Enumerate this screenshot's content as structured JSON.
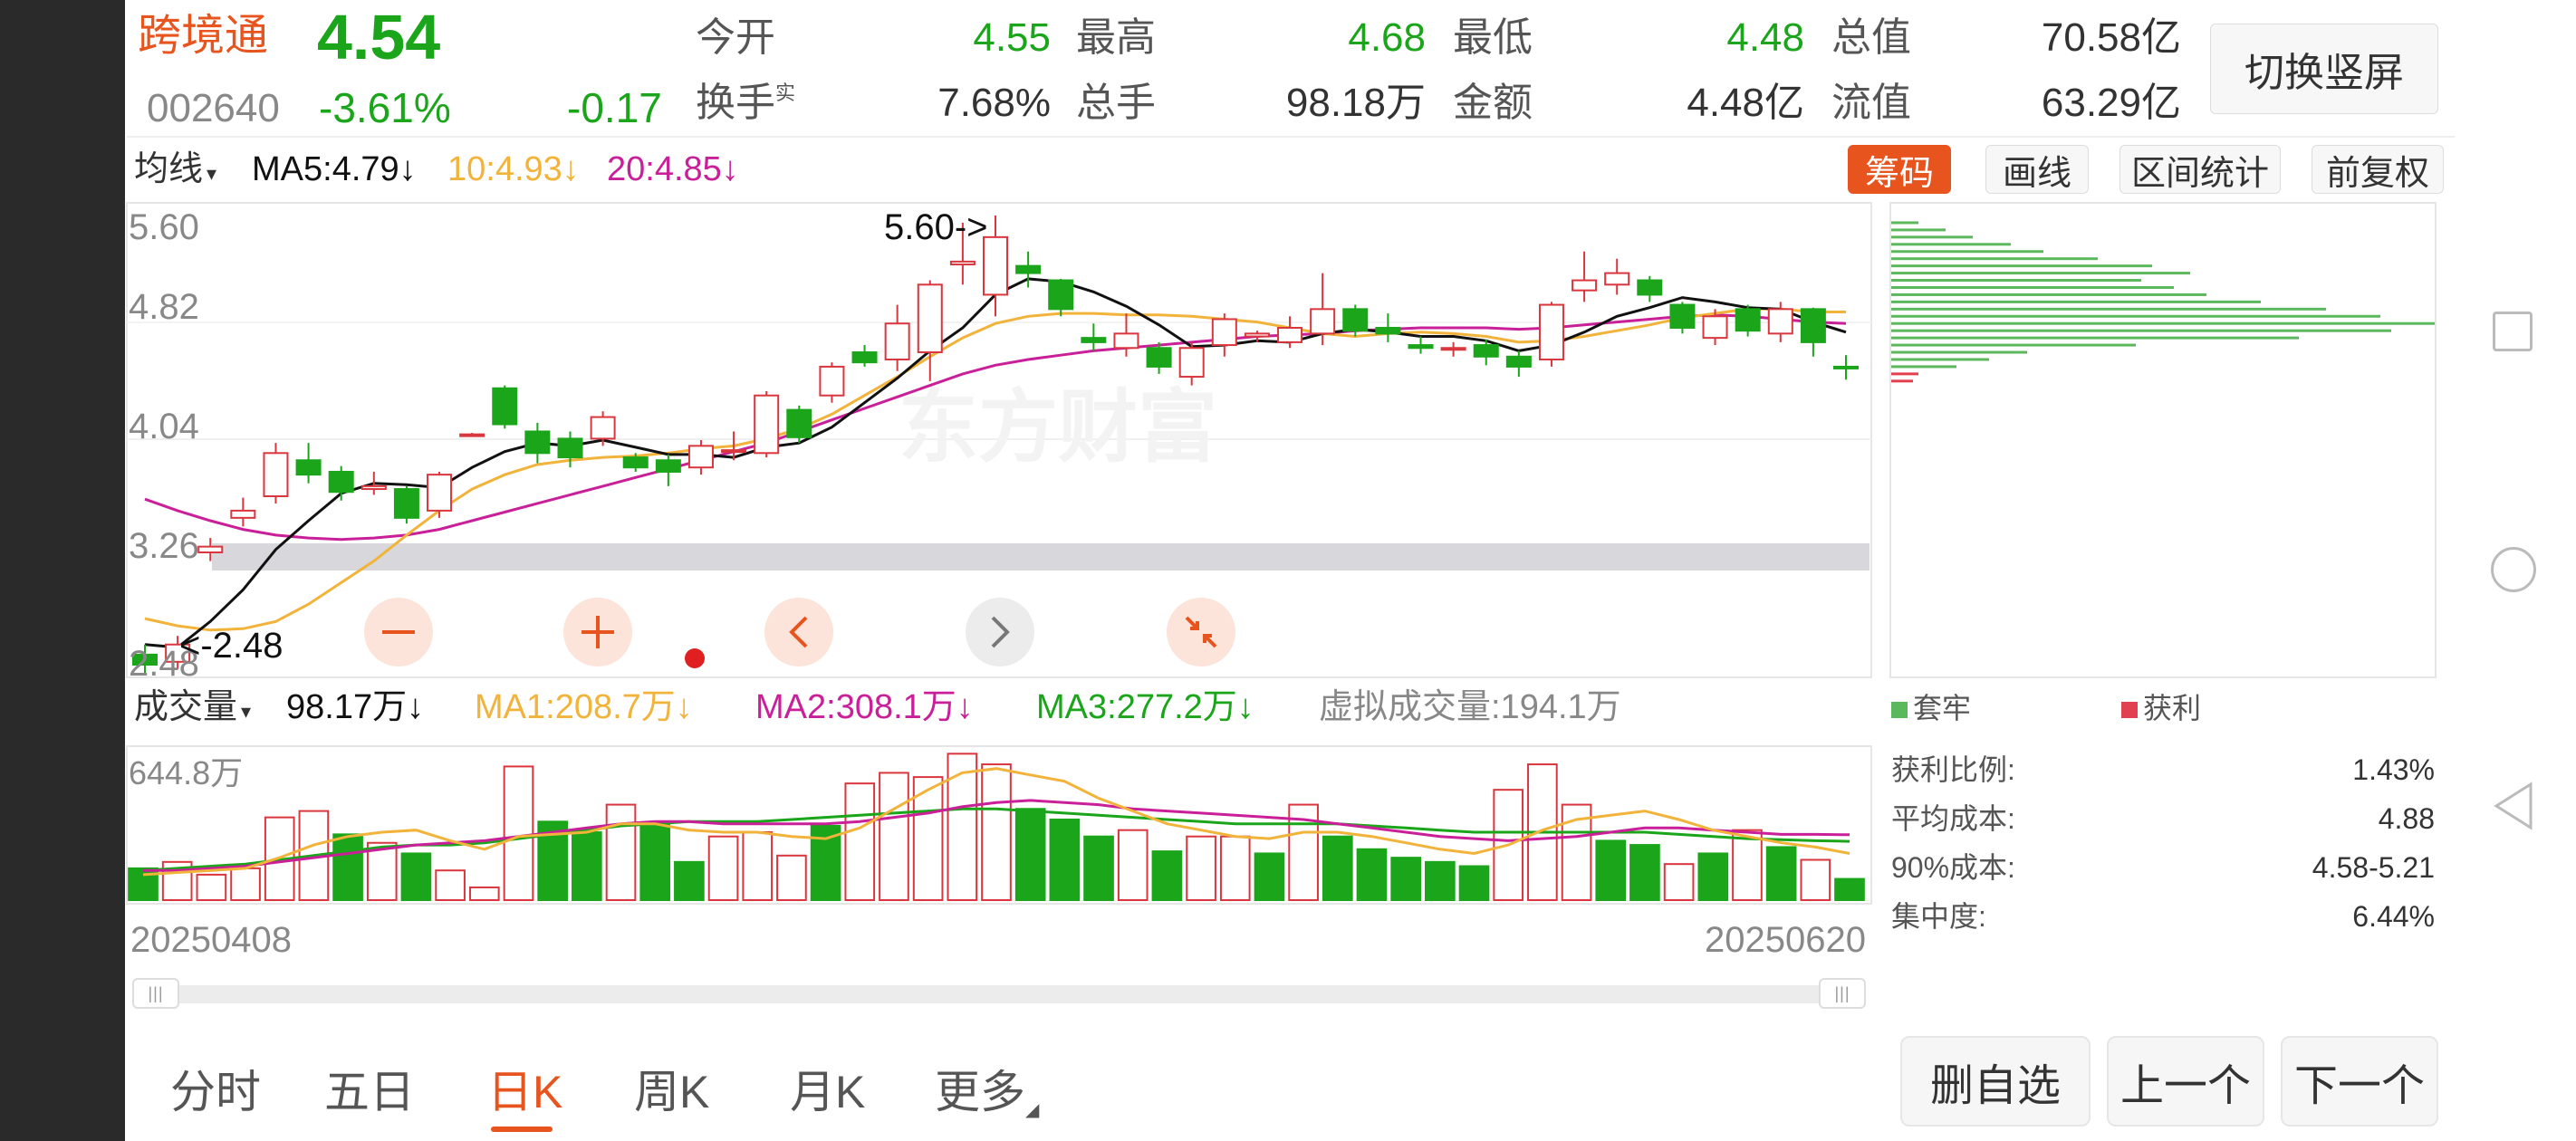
{
  "header": {
    "name": "跨境通",
    "price": "4.54",
    "code": "002640",
    "change_pct": "-3.61%",
    "change_abs": "-0.17",
    "stats": [
      {
        "label": "今开",
        "value": "4.55"
      },
      {
        "label": "最高",
        "value": "4.68"
      },
      {
        "label": "最低",
        "value": "4.48"
      },
      {
        "label": "总值",
        "value": "70.58亿"
      },
      {
        "label": "换手",
        "sup": "实",
        "value": "7.68%"
      },
      {
        "label": "总手",
        "value": "98.18万"
      },
      {
        "label": "金额",
        "value": "4.48亿"
      },
      {
        "label": "流值",
        "value": "63.29亿"
      }
    ],
    "switch_button": "切换竖屏"
  },
  "ma_bar": {
    "dropdown": "均线",
    "ma5": "MA5:4.79",
    "ma10": "10:4.93",
    "ma20": "20:4.85",
    "arrow": "↓",
    "tools": [
      "筹码",
      "画线",
      "区间统计",
      "前复权"
    ]
  },
  "kline": {
    "y_labels": [
      "5.60",
      "4.82",
      "4.04",
      "3.26",
      "2.48"
    ],
    "high_annotation": "5.60->",
    "low_annotation": "<-2.48",
    "watermark": "东方财富"
  },
  "volume_bar": {
    "dropdown": "成交量",
    "vol": "98.17万",
    "ma1": "MA1:208.7万",
    "ma2": "MA2:308.1万",
    "ma3": "MA3:277.2万",
    "arrow": "↓",
    "virtual": "虚拟成交量:194.1万",
    "y_label": "644.8万",
    "date_start": "20250408",
    "date_end": "20250620"
  },
  "chip": {
    "legend_trapped": "套牢",
    "legend_profit": "获利",
    "rows": [
      {
        "label": "获利比例:",
        "value": "1.43%"
      },
      {
        "label": "平均成本:",
        "value": "4.88"
      },
      {
        "label": "90%成本:",
        "value": "4.58-5.21"
      },
      {
        "label": "集中度:",
        "value": "6.44%"
      }
    ]
  },
  "tabs": [
    "分时",
    "五日",
    "日K",
    "周K",
    "月K",
    "更多"
  ],
  "active_tab": "日K",
  "bottom_buttons": [
    "删自选",
    "上一个",
    "下一个"
  ],
  "colors": {
    "up": "#d9363e",
    "down": "#1aa51a",
    "ma5": "#111111",
    "ma10": "#f2b33b",
    "ma20": "#c9209a",
    "accent": "#e8541e"
  },
  "chart_data": {
    "type": "candlestick",
    "price_axis": [
      2.48,
      5.6
    ],
    "ma_legend": {
      "MA5": 4.79,
      "MA10": 4.93,
      "MA20": 4.85
    },
    "candles": [
      {
        "o": 2.55,
        "c": 2.48,
        "h": 2.62,
        "l": 2.42
      },
      {
        "o": 2.5,
        "c": 2.62,
        "h": 2.68,
        "l": 2.45
      },
      {
        "o": 3.26,
        "c": 3.3,
        "h": 3.36,
        "l": 3.2
      },
      {
        "o": 3.5,
        "c": 3.55,
        "h": 3.64,
        "l": 3.44
      },
      {
        "o": 3.65,
        "c": 3.95,
        "h": 4.02,
        "l": 3.6
      },
      {
        "o": 3.9,
        "c": 3.8,
        "h": 4.02,
        "l": 3.74
      },
      {
        "o": 3.82,
        "c": 3.68,
        "h": 3.86,
        "l": 3.62
      },
      {
        "o": 3.7,
        "c": 3.72,
        "h": 3.82,
        "l": 3.66
      },
      {
        "o": 3.7,
        "c": 3.5,
        "h": 3.72,
        "l": 3.46
      },
      {
        "o": 3.55,
        "c": 3.8,
        "h": 3.82,
        "l": 3.5
      },
      {
        "o": 4.08,
        "c": 4.08,
        "h": 4.09,
        "l": 4.07
      },
      {
        "o": 4.4,
        "c": 4.15,
        "h": 4.42,
        "l": 4.12
      },
      {
        "o": 4.1,
        "c": 3.95,
        "h": 4.16,
        "l": 3.88
      },
      {
        "o": 4.05,
        "c": 3.92,
        "h": 4.1,
        "l": 3.85
      },
      {
        "o": 4.05,
        "c": 4.2,
        "h": 4.24,
        "l": 4.0
      },
      {
        "o": 3.92,
        "c": 3.85,
        "h": 3.95,
        "l": 3.82
      },
      {
        "o": 3.9,
        "c": 3.82,
        "h": 3.94,
        "l": 3.72
      },
      {
        "o": 3.85,
        "c": 4.0,
        "h": 4.04,
        "l": 3.8
      },
      {
        "o": 3.96,
        "c": 3.97,
        "h": 4.1,
        "l": 3.9
      },
      {
        "o": 3.95,
        "c": 4.35,
        "h": 4.38,
        "l": 3.92
      },
      {
        "o": 4.25,
        "c": 4.06,
        "h": 4.28,
        "l": 4.02
      },
      {
        "o": 4.35,
        "c": 4.55,
        "h": 4.58,
        "l": 4.3
      },
      {
        "o": 4.65,
        "c": 4.58,
        "h": 4.7,
        "l": 4.55
      },
      {
        "o": 4.6,
        "c": 4.85,
        "h": 4.98,
        "l": 4.52
      },
      {
        "o": 4.65,
        "c": 5.12,
        "h": 5.15,
        "l": 4.45
      },
      {
        "o": 5.26,
        "c": 5.28,
        "h": 5.55,
        "l": 5.12
      },
      {
        "o": 5.05,
        "c": 5.45,
        "h": 5.6,
        "l": 4.9
      },
      {
        "o": 5.25,
        "c": 5.2,
        "h": 5.35,
        "l": 5.1
      },
      {
        "o": 5.15,
        "c": 4.95,
        "h": 5.16,
        "l": 4.9
      },
      {
        "o": 4.75,
        "c": 4.72,
        "h": 4.85,
        "l": 4.66
      },
      {
        "o": 4.68,
        "c": 4.78,
        "h": 4.92,
        "l": 4.62
      },
      {
        "o": 4.68,
        "c": 4.55,
        "h": 4.72,
        "l": 4.5
      },
      {
        "o": 4.48,
        "c": 4.68,
        "h": 4.72,
        "l": 4.42
      },
      {
        "o": 4.7,
        "c": 4.88,
        "h": 4.92,
        "l": 4.62
      },
      {
        "o": 4.76,
        "c": 4.78,
        "h": 4.8,
        "l": 4.72
      },
      {
        "o": 4.72,
        "c": 4.82,
        "h": 4.9,
        "l": 4.68
      },
      {
        "o": 4.78,
        "c": 4.95,
        "h": 5.2,
        "l": 4.7
      },
      {
        "o": 4.95,
        "c": 4.8,
        "h": 4.98,
        "l": 4.76
      },
      {
        "o": 4.82,
        "c": 4.78,
        "h": 4.92,
        "l": 4.72
      },
      {
        "o": 4.7,
        "c": 4.68,
        "h": 4.76,
        "l": 4.64
      },
      {
        "o": 4.68,
        "c": 4.68,
        "h": 4.72,
        "l": 4.62
      },
      {
        "o": 4.7,
        "c": 4.62,
        "h": 4.74,
        "l": 4.56
      },
      {
        "o": 4.62,
        "c": 4.55,
        "h": 4.66,
        "l": 4.48
      },
      {
        "o": 4.6,
        "c": 4.98,
        "h": 5.0,
        "l": 4.55
      },
      {
        "o": 5.08,
        "c": 5.15,
        "h": 5.35,
        "l": 5.0
      },
      {
        "o": 5.12,
        "c": 5.2,
        "h": 5.3,
        "l": 5.05
      },
      {
        "o": 5.15,
        "c": 5.05,
        "h": 5.18,
        "l": 5.0
      },
      {
        "o": 4.98,
        "c": 4.82,
        "h": 5.0,
        "l": 4.78
      },
      {
        "o": 4.75,
        "c": 4.9,
        "h": 4.95,
        "l": 4.7
      },
      {
        "o": 4.95,
        "c": 4.8,
        "h": 4.98,
        "l": 4.76
      },
      {
        "o": 4.78,
        "c": 4.95,
        "h": 5.0,
        "l": 4.72
      },
      {
        "o": 4.95,
        "c": 4.72,
        "h": 4.96,
        "l": 4.62
      },
      {
        "o": 4.55,
        "c": 4.54,
        "h": 4.63,
        "l": 4.46
      }
    ],
    "ma5": [
      2.62,
      2.6,
      2.78,
      3.0,
      3.28,
      3.48,
      3.67,
      3.74,
      3.73,
      3.71,
      3.85,
      3.96,
      4.02,
      4.0,
      4.04,
      3.99,
      3.94,
      3.94,
      3.92,
      3.99,
      4.02,
      4.13,
      4.3,
      4.47,
      4.66,
      4.82,
      5.05,
      5.16,
      5.14,
      5.07,
      4.97,
      4.84,
      4.69,
      4.7,
      4.73,
      4.72,
      4.78,
      4.81,
      4.79,
      4.76,
      4.76,
      4.73,
      4.66,
      4.7,
      4.79,
      4.9,
      4.96,
      5.03,
      5.0,
      4.96,
      4.95,
      4.86,
      4.79
    ],
    "ma10": [
      2.8,
      2.75,
      2.72,
      2.73,
      2.78,
      2.9,
      3.05,
      3.2,
      3.38,
      3.55,
      3.7,
      3.8,
      3.87,
      3.9,
      3.92,
      3.93,
      3.95,
      3.98,
      4.0,
      4.05,
      4.12,
      4.22,
      4.35,
      4.48,
      4.62,
      4.75,
      4.85,
      4.9,
      4.92,
      4.92,
      4.91,
      4.91,
      4.9,
      4.88,
      4.86,
      4.82,
      4.78,
      4.76,
      4.78,
      4.79,
      4.78,
      4.76,
      4.72,
      4.73,
      4.76,
      4.8,
      4.84,
      4.89,
      4.92,
      4.95,
      4.95,
      4.93,
      4.93
    ],
    "ma20": [
      3.63,
      3.55,
      3.48,
      3.42,
      3.38,
      3.36,
      3.35,
      3.36,
      3.38,
      3.42,
      3.48,
      3.54,
      3.6,
      3.66,
      3.72,
      3.78,
      3.84,
      3.9,
      3.96,
      4.02,
      4.1,
      4.18,
      4.26,
      4.34,
      4.42,
      4.5,
      4.56,
      4.6,
      4.63,
      4.66,
      4.68,
      4.7,
      4.72,
      4.74,
      4.76,
      4.77,
      4.78,
      4.8,
      4.81,
      4.82,
      4.82,
      4.82,
      4.81,
      4.82,
      4.84,
      4.86,
      4.88,
      4.9,
      4.91,
      4.9,
      4.88,
      4.86,
      4.85
    ],
    "volume": [
      {
        "v": 150,
        "up": false
      },
      {
        "v": 180,
        "up": true
      },
      {
        "v": 120,
        "up": true
      },
      {
        "v": 150,
        "up": true
      },
      {
        "v": 390,
        "up": true
      },
      {
        "v": 420,
        "up": true
      },
      {
        "v": 310,
        "up": false
      },
      {
        "v": 270,
        "up": true
      },
      {
        "v": 220,
        "up": false
      },
      {
        "v": 140,
        "up": true
      },
      {
        "v": 60,
        "up": true
      },
      {
        "v": 630,
        "up": true
      },
      {
        "v": 370,
        "up": false
      },
      {
        "v": 320,
        "up": false
      },
      {
        "v": 450,
        "up": true
      },
      {
        "v": 360,
        "up": false
      },
      {
        "v": 180,
        "up": false
      },
      {
        "v": 300,
        "up": true
      },
      {
        "v": 320,
        "up": true
      },
      {
        "v": 210,
        "up": true
      },
      {
        "v": 350,
        "up": false
      },
      {
        "v": 550,
        "up": true
      },
      {
        "v": 600,
        "up": true
      },
      {
        "v": 580,
        "up": true
      },
      {
        "v": 690,
        "up": true
      },
      {
        "v": 640,
        "up": true
      },
      {
        "v": 430,
        "up": false
      },
      {
        "v": 380,
        "up": false
      },
      {
        "v": 300,
        "up": false
      },
      {
        "v": 330,
        "up": true
      },
      {
        "v": 230,
        "up": false
      },
      {
        "v": 300,
        "up": true
      },
      {
        "v": 300,
        "up": true
      },
      {
        "v": 220,
        "up": false
      },
      {
        "v": 450,
        "up": true
      },
      {
        "v": 300,
        "up": false
      },
      {
        "v": 240,
        "up": false
      },
      {
        "v": 200,
        "up": false
      },
      {
        "v": 180,
        "up": false
      },
      {
        "v": 160,
        "up": false
      },
      {
        "v": 520,
        "up": true
      },
      {
        "v": 640,
        "up": true
      },
      {
        "v": 450,
        "up": true
      },
      {
        "v": 280,
        "up": false
      },
      {
        "v": 260,
        "up": false
      },
      {
        "v": 170,
        "up": true
      },
      {
        "v": 220,
        "up": false
      },
      {
        "v": 330,
        "up": true
      },
      {
        "v": 250,
        "up": false
      },
      {
        "v": 190,
        "up": true
      },
      {
        "v": 100,
        "up": false
      }
    ],
    "vol_ma1": [
      120,
      130,
      140,
      150,
      200,
      260,
      300,
      320,
      330,
      280,
      240,
      300,
      310,
      320,
      360,
      360,
      330,
      320,
      320,
      300,
      290,
      340,
      430,
      520,
      600,
      620,
      590,
      560,
      480,
      420,
      360,
      330,
      300,
      290,
      320,
      320,
      300,
      270,
      240,
      220,
      260,
      330,
      380,
      400,
      420,
      380,
      330,
      300,
      270,
      250,
      220
    ],
    "vol_ma2": [
      140,
      140,
      150,
      160,
      180,
      200,
      220,
      240,
      260,
      270,
      280,
      300,
      320,
      340,
      360,
      370,
      370,
      360,
      360,
      360,
      360,
      370,
      390,
      410,
      440,
      460,
      470,
      460,
      450,
      430,
      420,
      410,
      400,
      390,
      380,
      360,
      340,
      320,
      300,
      290,
      280,
      290,
      300,
      320,
      340,
      340,
      330,
      320,
      310,
      310,
      308
    ],
    "vol_ma3": [
      140,
      150,
      160,
      170,
      190,
      210,
      230,
      250,
      260,
      260,
      270,
      290,
      310,
      330,
      350,
      360,
      370,
      370,
      370,
      380,
      390,
      400,
      410,
      420,
      430,
      430,
      420,
      410,
      400,
      390,
      380,
      370,
      360,
      360,
      360,
      360,
      350,
      340,
      330,
      320,
      320,
      320,
      320,
      320,
      320,
      310,
      300,
      290,
      285,
      280,
      277
    ],
    "chip_dist": [
      {
        "p": 5.55,
        "w": 0.05,
        "t": "trapped"
      },
      {
        "p": 5.5,
        "w": 0.1,
        "t": "trapped"
      },
      {
        "p": 5.45,
        "w": 0.15,
        "t": "trapped"
      },
      {
        "p": 5.4,
        "w": 0.22,
        "t": "trapped"
      },
      {
        "p": 5.35,
        "w": 0.28,
        "t": "trapped"
      },
      {
        "p": 5.3,
        "w": 0.38,
        "t": "trapped"
      },
      {
        "p": 5.25,
        "w": 0.48,
        "t": "trapped"
      },
      {
        "p": 5.2,
        "w": 0.55,
        "t": "trapped"
      },
      {
        "p": 5.15,
        "w": 0.46,
        "t": "trapped"
      },
      {
        "p": 5.1,
        "w": 0.52,
        "t": "trapped"
      },
      {
        "p": 5.05,
        "w": 0.58,
        "t": "trapped"
      },
      {
        "p": 5.0,
        "w": 0.68,
        "t": "trapped"
      },
      {
        "p": 4.95,
        "w": 0.8,
        "t": "trapped"
      },
      {
        "p": 4.9,
        "w": 0.9,
        "t": "trapped"
      },
      {
        "p": 4.85,
        "w": 1.0,
        "t": "trapped"
      },
      {
        "p": 4.8,
        "w": 0.92,
        "t": "trapped"
      },
      {
        "p": 4.75,
        "w": 0.75,
        "t": "trapped"
      },
      {
        "p": 4.7,
        "w": 0.45,
        "t": "trapped"
      },
      {
        "p": 4.65,
        "w": 0.25,
        "t": "trapped"
      },
      {
        "p": 4.6,
        "w": 0.18,
        "t": "trapped"
      },
      {
        "p": 4.55,
        "w": 0.12,
        "t": "trapped"
      },
      {
        "p": 4.5,
        "w": 0.05,
        "t": "profit"
      },
      {
        "p": 4.45,
        "w": 0.04,
        "t": "profit"
      }
    ]
  }
}
